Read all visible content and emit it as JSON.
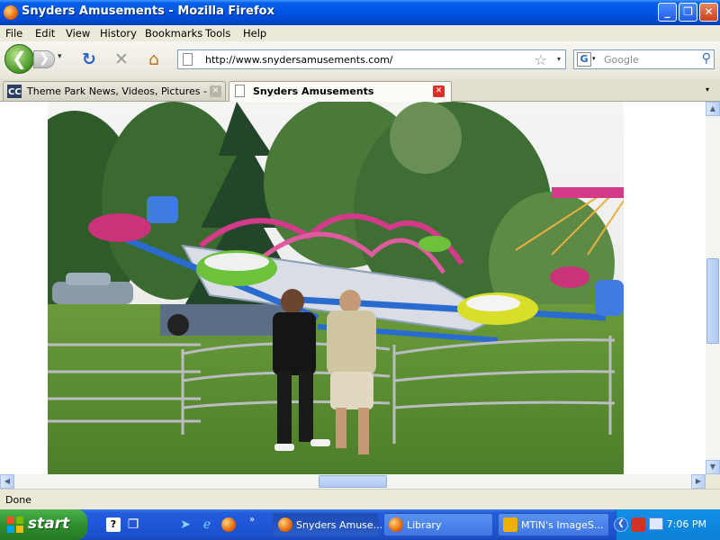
{
  "window": {
    "title": "Snyders Amusements - Mozilla Firefox",
    "minimize_glyph": "_",
    "restore_glyph": "❐",
    "close_glyph": "✕"
  },
  "menu": [
    {
      "label": "File"
    },
    {
      "label": "Edit"
    },
    {
      "label": "View"
    },
    {
      "label": "History"
    },
    {
      "label": "Bookmarks"
    },
    {
      "label": "Tools"
    },
    {
      "label": "Help"
    }
  ],
  "nav": {
    "back_glyph": "❮",
    "forward_glyph": "❯",
    "dropdown_glyph": "▾",
    "reload_glyph": "↻",
    "stop_glyph": "✕",
    "home_glyph": "⌂",
    "url": "http://www.snydersamusements.com/",
    "bookmark_star": "☆",
    "url_dropdown": "▾"
  },
  "search": {
    "engine_letter": "G",
    "engine_dropdown": "▾",
    "placeholder": "Google",
    "search_glyph": "⚲"
  },
  "tabs": [
    {
      "label": "Theme Park News, Videos, Pictures - N...",
      "active": false,
      "close": "✕"
    },
    {
      "label": "Snyders Amusements",
      "active": true,
      "close": "✕"
    }
  ],
  "tab_list_arrow": "▾",
  "scrollbars": {
    "up": "▲",
    "down": "▼",
    "left": "◀",
    "right": "▶",
    "v_position": 0.55,
    "h_position": 0.5
  },
  "status": {
    "text": "Done"
  },
  "taskbar": {
    "start_label": "start",
    "tasks": [
      {
        "label": "Snyders Amuse...",
        "active": true
      },
      {
        "label": "Library",
        "active": false
      },
      {
        "label": "MTiN's ImageS...",
        "active": false
      }
    ],
    "clock": "7:06 PM"
  },
  "colors": {
    "titlebar": "#0054e3",
    "taskbar": "#245edb",
    "start_button": "#2f8f2f",
    "close_tab": "#d9312a"
  }
}
